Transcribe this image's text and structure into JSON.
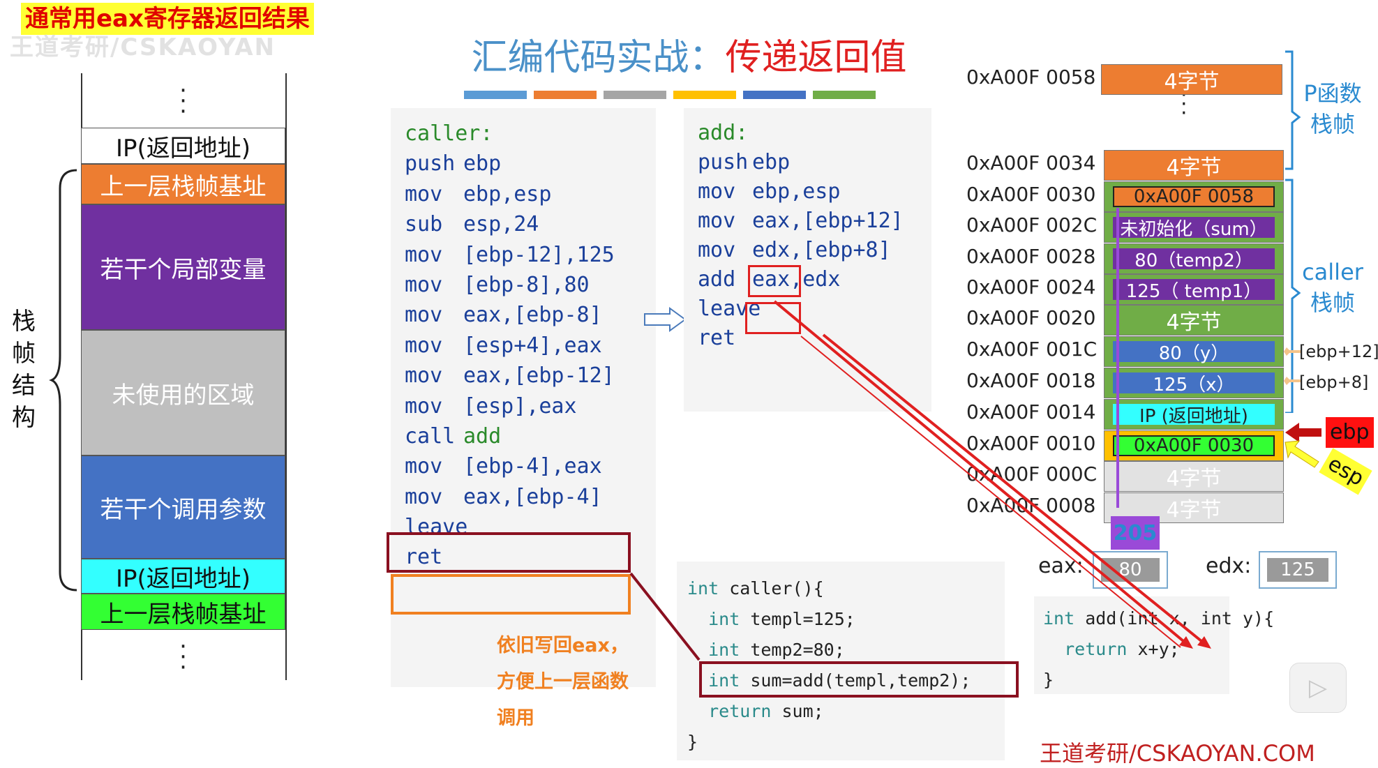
{
  "top_note": "通常用eax寄存器返回结果",
  "watermark": "王道考研/CSKAOYAN",
  "title": {
    "part1": "汇编代码实战：",
    "part2": "传递返回值"
  },
  "color_bar": [
    "#5b9bd5",
    "#ed7d31",
    "#a5a5a5",
    "#ffc000",
    "#4472c4",
    "#70ad47"
  ],
  "left_stack": {
    "brace_label": "栈帧结构",
    "blocks": [
      {
        "label": "IP(返回地址)",
        "color": "#ffffff",
        "text_color": "#111111"
      },
      {
        "label": "上一层栈帧基址",
        "color": "#ed7d31",
        "text_color": "#ffffff"
      },
      {
        "label": "若干个局部变量",
        "color": "#7030a0",
        "text_color": "#ffffff"
      },
      {
        "label": "未使用的区域",
        "color": "#bfbfbf",
        "text_color": "#ffffff"
      },
      {
        "label": "若干个调用参数",
        "color": "#4472c4",
        "text_color": "#ffffff"
      },
      {
        "label": "IP(返回地址)",
        "color": "#33ffff",
        "text_color": "#111111"
      },
      {
        "label": "上一层栈帧基址",
        "color": "#33ff33",
        "text_color": "#111111"
      }
    ]
  },
  "caller_asm": [
    {
      "op": "caller:",
      "args": ""
    },
    {
      "op": "push",
      "args": "ebp"
    },
    {
      "op": "mov",
      "args": "ebp,esp"
    },
    {
      "op": "sub",
      "args": "esp,24"
    },
    {
      "op": "mov",
      "args": "[ebp-12],125"
    },
    {
      "op": "mov",
      "args": "[ebp-8],80"
    },
    {
      "op": "mov",
      "args": "eax,[ebp-8]"
    },
    {
      "op": "mov",
      "args": "[esp+4],eax"
    },
    {
      "op": "mov",
      "args": "eax,[ebp-12]"
    },
    {
      "op": "mov",
      "args": "[esp],eax"
    },
    {
      "op": "call",
      "args": "add"
    },
    {
      "op": "mov",
      "args": "[ebp-4],eax"
    },
    {
      "op": "mov",
      "args": "eax,[ebp-4]"
    },
    {
      "op": "leave",
      "args": ""
    },
    {
      "op": "ret",
      "args": ""
    }
  ],
  "add_asm": [
    {
      "op": "add:",
      "args": ""
    },
    {
      "op": "push",
      "args": "ebp"
    },
    {
      "op": "mov",
      "args": "ebp,esp"
    },
    {
      "op": "mov",
      "args": "eax,[ebp+12]"
    },
    {
      "op": "mov",
      "args": "edx,[ebp+8]"
    },
    {
      "op": "add",
      "args": "eax,edx"
    },
    {
      "op": "leave",
      "args": ""
    },
    {
      "op": "ret",
      "args": ""
    }
  ],
  "note_writeback": [
    "依旧写回eax，",
    "方便上一层函数",
    "调用"
  ],
  "c_caller": [
    "int caller(){",
    "  int templ=125;",
    "  int temp2=80;",
    "  int sum=add(templ,temp2);",
    "  return sum;",
    "}"
  ],
  "c_add": [
    "int add(int x, int y){",
    "  return x+y;",
    "}"
  ],
  "memory": {
    "addresses": [
      "0xA00F 0058",
      "0xA00F 0034",
      "0xA00F 0030",
      "0xA00F 002C",
      "0xA00F 0028",
      "0xA00F 0024",
      "0xA00F 0020",
      "0xA00F 001C",
      "0xA00F 0018",
      "0xA00F 0014",
      "0xA00F 0010",
      "0xA00F 000C",
      "0xA00F 0008"
    ],
    "cells": [
      {
        "label": "4字节"
      },
      {
        "label": "4字节"
      },
      {
        "label": "0xA00F 0058"
      },
      {
        "label": "未初始化（sum）"
      },
      {
        "label": "80（temp2）"
      },
      {
        "label": "125（ temp1）"
      },
      {
        "label": "4字节"
      },
      {
        "label": "80（y）"
      },
      {
        "label": "125（x）"
      },
      {
        "label": "IP (返回地址)"
      },
      {
        "label": "0xA00F 0030"
      },
      {
        "label": "4字节"
      },
      {
        "label": "4字节"
      }
    ],
    "p_frame_label": "P函数栈帧",
    "caller_frame_label": "caller栈帧",
    "ebp_plus_12": "[ebp+12]",
    "ebp_plus_8": "[ebp+8]",
    "ebp": "ebp",
    "esp": "esp",
    "result_value": "205"
  },
  "registers": {
    "eax_label": "eax:",
    "eax_value": "80",
    "edx_label": "edx:",
    "edx_value": "125"
  },
  "footer": "王道考研/CSKAOYAN.COM",
  "colors": {
    "orange": "#ed7d31",
    "green": "#70ad47",
    "purple": "#7030a0",
    "blue": "#4472c4",
    "cyan": "#33ffff",
    "red": "#e02020"
  }
}
